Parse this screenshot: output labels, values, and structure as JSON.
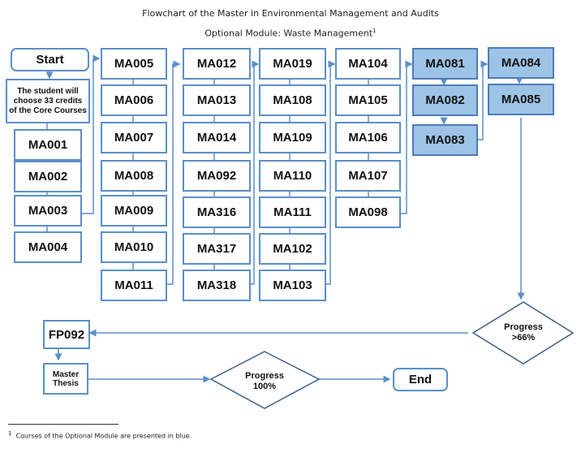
{
  "title": "Flowchart of the Master in Environmental Management and Audits",
  "subtitle": "Optional Module: Waste Management",
  "subtitle_footnote_mark": "1",
  "start_label": "Start",
  "core_note": "The student will choose 33 credits of the Core Courses",
  "columns": [
    [
      "MA001",
      "MA002",
      "MA003",
      "MA004"
    ],
    [
      "MA005",
      "MA006",
      "MA007",
      "MA008",
      "MA009",
      "MA010",
      "MA011"
    ],
    [
      "MA012",
      "MA013",
      "MA014",
      "MA092",
      "MA316",
      "MA317",
      "MA318"
    ],
    [
      "MA019",
      "MA108",
      "MA109",
      "MA110",
      "MA111",
      "MA102",
      "MA103"
    ],
    [
      "MA104",
      "MA105",
      "MA106",
      "MA107",
      "MA098"
    ]
  ],
  "optional_module": {
    "color": "#9dc3e6",
    "col1": [
      "MA081",
      "MA082",
      "MA083"
    ],
    "col2": [
      "MA084",
      "MA085"
    ]
  },
  "decision_progress_66": {
    "line1": "Progress",
    "line2": ">66%"
  },
  "fp_label": "FP092",
  "thesis_label": "Master Thesis",
  "decision_progress_100": {
    "line1": "Progress",
    "line2": "100%"
  },
  "end_label": "End",
  "footnote": {
    "mark": "1",
    "text": "Courses of the Optional Module are presented in blue."
  },
  "colors": {
    "line": "#5b8fc9",
    "optional_fill": "#9dc3e6"
  }
}
